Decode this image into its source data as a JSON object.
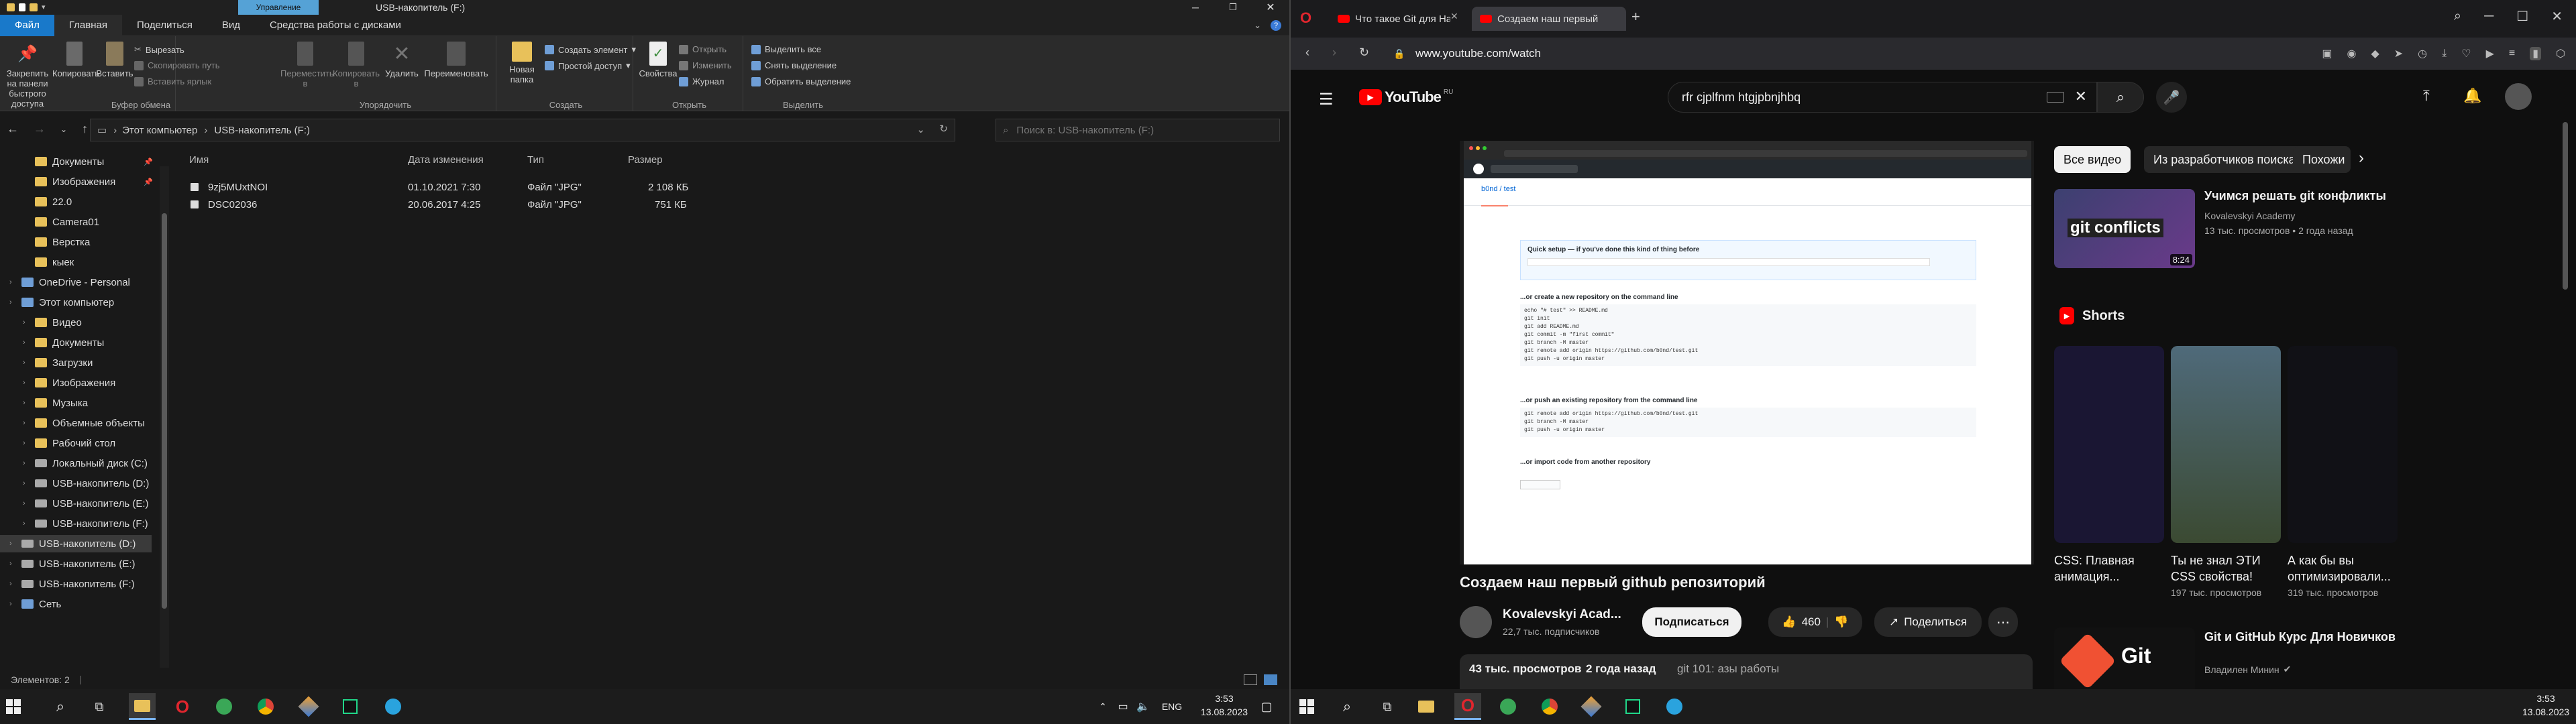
{
  "explorer": {
    "window_title": "USB-накопитель (F:)",
    "manage_tab": "Управление",
    "tabs": [
      "Файл",
      "Главная",
      "Поделиться",
      "Вид",
      "Средства работы с дисками"
    ],
    "ribbon": {
      "clipboard": {
        "pin": "Закрепить на панели быстрого доступа",
        "copy": "Копировать",
        "paste": "Вставить",
        "cut": "Вырезать",
        "copy_path": "Скопировать путь",
        "paste_shortcut": "Вставить ярлык",
        "label": "Буфер обмена"
      },
      "organize": {
        "move": "Переместить в",
        "copy_to": "Копировать в",
        "delete": "Удалить",
        "rename": "Переименовать",
        "label": "Упорядочить"
      },
      "create": {
        "new_folder": "Новая папка",
        "new_item": "Создать элемент",
        "easy_access": "Простой доступ",
        "label": "Создать"
      },
      "open": {
        "properties": "Свойства",
        "open": "Открыть",
        "edit": "Изменить",
        "history": "Журнал",
        "label": "Открыть"
      },
      "select": {
        "select_all": "Выделить все",
        "select_none": "Снять выделение",
        "invert": "Обратить выделение",
        "label": "Выделить"
      }
    },
    "breadcrumb": [
      "Этот компьютер",
      "USB-накопитель (F:)"
    ],
    "search_placeholder": "Поиск в: USB-накопитель (F:)",
    "tree": [
      {
        "label": "Документы",
        "icon": "folder",
        "indent": 1
      },
      {
        "label": "Изображения",
        "icon": "folder",
        "indent": 1
      },
      {
        "label": "22.0",
        "icon": "folder",
        "indent": 1
      },
      {
        "label": "Camera01",
        "icon": "folder",
        "indent": 1
      },
      {
        "label": "Верстка",
        "icon": "folder",
        "indent": 1
      },
      {
        "label": "кыек",
        "icon": "folder",
        "indent": 1
      },
      {
        "label": "OneDrive - Personal",
        "icon": "cloud",
        "indent": 0
      },
      {
        "label": "Этот компьютер",
        "icon": "pc",
        "indent": 0
      },
      {
        "label": "Видео",
        "icon": "folder",
        "indent": 1
      },
      {
        "label": "Документы",
        "icon": "folder",
        "indent": 1
      },
      {
        "label": "Загрузки",
        "icon": "folder",
        "indent": 1
      },
      {
        "label": "Изображения",
        "icon": "folder",
        "indent": 1
      },
      {
        "label": "Музыка",
        "icon": "folder",
        "indent": 1
      },
      {
        "label": "Объемные объекты",
        "icon": "folder",
        "indent": 1
      },
      {
        "label": "Рабочий стол",
        "icon": "folder",
        "indent": 1
      },
      {
        "label": "Локальный диск (C:)",
        "icon": "drive",
        "indent": 1
      },
      {
        "label": "USB-накопитель (D:)",
        "icon": "drive",
        "indent": 1
      },
      {
        "label": "USB-накопитель (E:)",
        "icon": "drive",
        "indent": 1
      },
      {
        "label": "USB-накопитель (F:)",
        "icon": "drive",
        "indent": 1
      },
      {
        "label": "USB-накопитель (D:)",
        "icon": "drive",
        "indent": 0
      },
      {
        "label": "USB-накопитель (E:)",
        "icon": "drive",
        "indent": 0
      },
      {
        "label": "USB-накопитель (F:)",
        "icon": "drive",
        "indent": 0
      },
      {
        "label": "Сеть",
        "icon": "network",
        "indent": 0
      }
    ],
    "columns": [
      "Имя",
      "Дата изменения",
      "Тип",
      "Размер"
    ],
    "files": [
      {
        "name": "9zj5MUxtNOI",
        "date": "01.10.2021 7:30",
        "type": "Файл \"JPG\"",
        "size": "2 108 КБ"
      },
      {
        "name": "DSC02036",
        "date": "20.06.2017 4:25",
        "type": "Файл \"JPG\"",
        "size": "751 КБ"
      }
    ],
    "status": "Элементов: 2"
  },
  "taskbar": {
    "lang": "ENG",
    "time": "3:53",
    "date": "13.08.2023"
  },
  "browser": {
    "tabs": [
      "Что такое Git для Начи",
      "Создаем наш первый"
    ],
    "url": "www.youtube.com/watch",
    "search_query": "rfr cjplfnm htgjpbnjhbq",
    "logo_text": "YouTube",
    "logo_region": "RU",
    "video": {
      "title": "Создаем наш первый github репозиторий",
      "channel": "Kovalevskyi Acad...",
      "subscribers": "22,7 тыс. подписчиков",
      "subscribe": "Подписаться",
      "likes": "460",
      "share": "Поделиться",
      "views": "43 тыс. просмотров",
      "ago": "2 года назад",
      "desc": "git 101: азы работы"
    },
    "github_page": {
      "repo": "b0nd / test",
      "quick_setup": "Quick setup — if you've done this kind of thing before",
      "create_new": "...or create a new repository on the command line",
      "push_existing": "...or push an existing repository from the command line",
      "import": "...or import code from another repository",
      "create_code": "echo \"# test\" >> README.md\ngit init\ngit add README.md\ngit commit -m \"first commit\"\ngit branch -M master\ngit remote add origin https://github.com/b0nd/test.git\ngit push -u origin master",
      "push_code": "git remote add origin https://github.com/b0nd/test.git\ngit branch -M master\ngit push -u origin master"
    },
    "chips": [
      "Все видео",
      "Из разработчиков поиска",
      "Похожи"
    ],
    "recommended": {
      "title": "Учимся решать git конфликты",
      "channel": "Kovalevskyi Academy",
      "meta": "13 тыс. просмотров • 2 года назад",
      "duration": "8:24",
      "thumb_text": "git conflicts"
    },
    "shorts_label": "Shorts",
    "shorts": [
      {
        "title": "CSS: Плавная анимация...",
        "views": "",
        "color": "#1a1633"
      },
      {
        "title": "Ты не знал ЭТИ CSS свойства!",
        "views": "197 тыс. просмотров",
        "color": "#3b4a32"
      },
      {
        "title": "А как бы вы оптимизировали...",
        "views": "319 тыс. просмотров",
        "color": "#111116"
      }
    ],
    "course": {
      "title": "Git и GitHub Курс Для Новичков",
      "channel": "Владилен Минин",
      "thumb_text": "Git"
    }
  }
}
